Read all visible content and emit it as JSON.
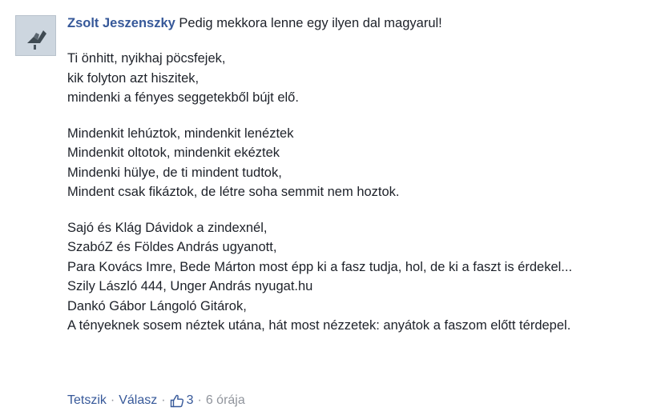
{
  "comment": {
    "author": "Zsolt Jeszenszky",
    "intro": "Pedig mekkora lenne egy ilyen dal magyarul!",
    "stanzas": [
      {
        "lines": [
          "Ti önhitt, nyikhaj pöcsfejek,",
          "kik folyton azt hiszitek,",
          "mindenki a fényes seggetekből bújt elő."
        ]
      },
      {
        "lines": [
          "Mindenkit lehúztok, mindenkit lenéztek",
          "Mindenkit oltotok, mindenkit ekéztek",
          "Mindenki hülye, de ti mindent tudtok,",
          "Mindent csak fikáztok, de létre soha semmit nem hoztok."
        ]
      },
      {
        "lines": [
          "Sajó és Klág Dávidok a zindexnél,",
          "SzabóZ és Földes András ugyanott,",
          "Para Kovács Imre, Bede Márton most épp ki a fasz tudja, hol, de ki a faszt is érdekel...",
          "Szily László 444, Unger András nyugat.hu",
          "Dankó Gábor Lángoló Gitárok,",
          "A tényeknek sosem néztek utána, hát most nézzetek: anyátok a faszom előtt térdepel."
        ]
      }
    ],
    "actions": {
      "like_label": "Tetszik",
      "reply_label": "Válasz",
      "like_count": "3",
      "timestamp": "6 órája",
      "separator": "·"
    }
  },
  "icons": {
    "like": "thumbs-up-icon",
    "avatar": "profile-photo"
  },
  "colors": {
    "link": "#365899",
    "text": "#1d2129",
    "meta": "#90949c"
  }
}
